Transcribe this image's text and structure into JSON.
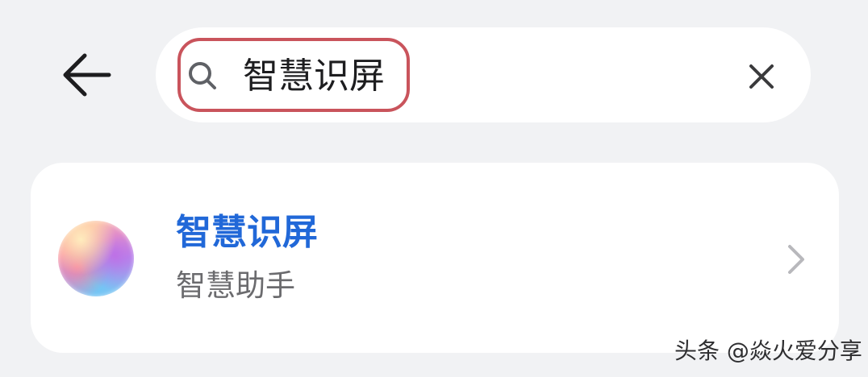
{
  "header": {
    "back_icon": "arrow-left-icon",
    "search": {
      "icon": "search-icon",
      "value": "智慧识屏",
      "clear_icon": "close-icon",
      "highlight_color": "#c9545c"
    }
  },
  "results": [
    {
      "icon": "smart-assistant-app-icon",
      "title": "智慧识屏",
      "subtitle": "智慧助手",
      "chevron_icon": "chevron-right-icon"
    }
  ],
  "watermark": {
    "text": "头条 @焱火爱分享"
  },
  "colors": {
    "background": "#f1f2f4",
    "card": "#ffffff",
    "accent": "#2168d8",
    "secondary_text": "#6b6b6e"
  }
}
